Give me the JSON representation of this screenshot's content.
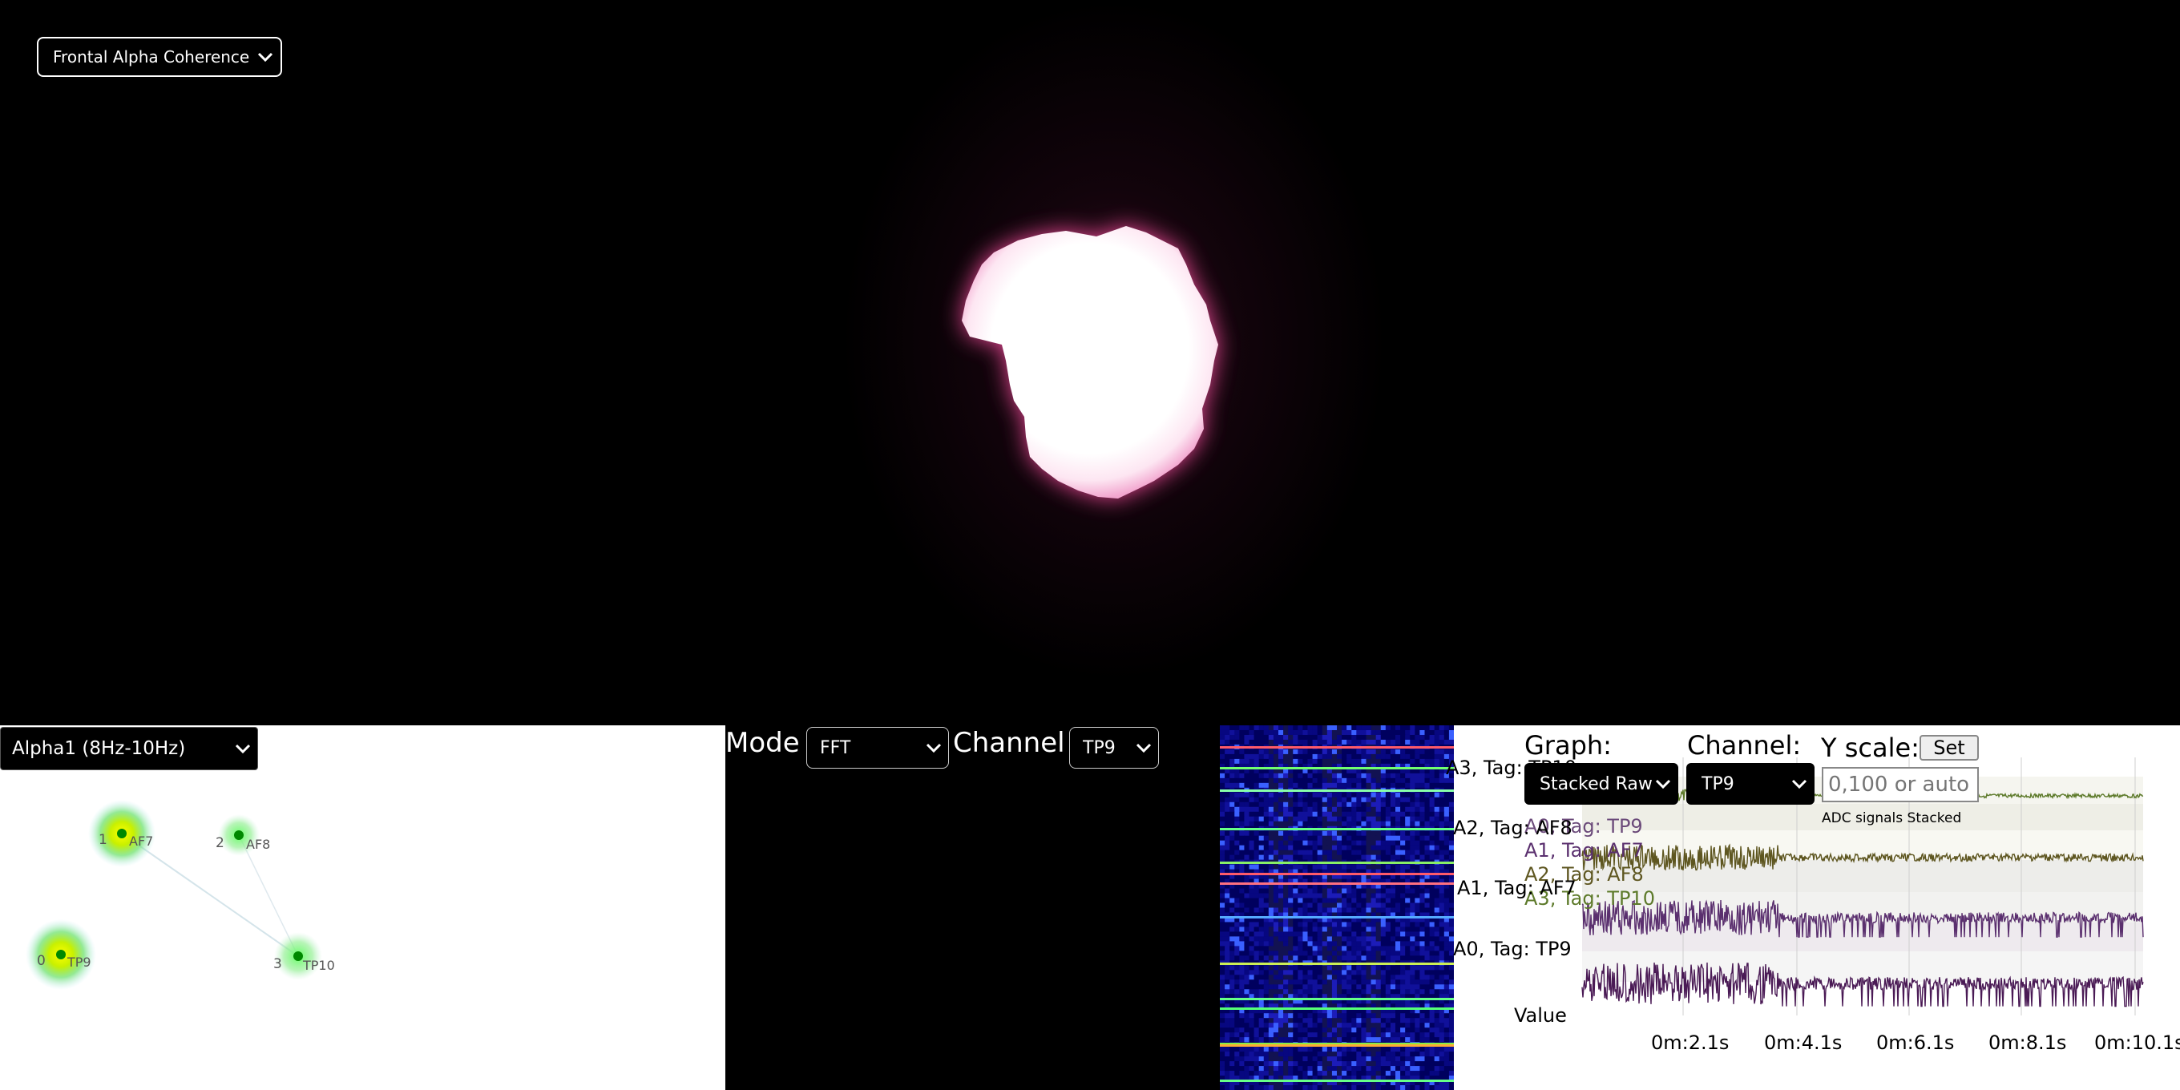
{
  "top": {
    "metric_select": {
      "value": "Frontal Alpha Coherence",
      "options": [
        "Frontal Alpha Coherence"
      ]
    }
  },
  "coherence": {
    "band_select": {
      "value": "Alpha1 (8Hz-10Hz)",
      "options": [
        "Alpha1 (8Hz-10Hz)"
      ]
    },
    "nodes": [
      {
        "index": "1",
        "tag": "AF7"
      },
      {
        "index": "2",
        "tag": "AF8"
      },
      {
        "index": "0",
        "tag": "TP9"
      },
      {
        "index": "3",
        "tag": "TP10"
      }
    ]
  },
  "fft": {
    "mode_label": "Mode",
    "mode_select": {
      "value": "FFT",
      "options": [
        "FFT"
      ]
    },
    "channel_label": "Channel",
    "channel_select": {
      "value": "TP9",
      "options": [
        "TP9"
      ]
    }
  },
  "graph": {
    "graph_label": "Graph:",
    "graph_select": {
      "value": "Stacked Raw",
      "options": [
        "Stacked Raw"
      ]
    },
    "channel_label": "Channel:",
    "channel_select": {
      "value": "TP9",
      "options": [
        "TP9"
      ]
    },
    "yscale_label": "Y scale:",
    "set_button": "Set",
    "yscale_input": {
      "value": "",
      "placeholder": "0,100 or auto"
    },
    "chart_title": "ADC signals Stacked",
    "legend": [
      "A0, Tag: TP9",
      "A1, Tag: AF7",
      "A2, Tag: AF8",
      "A3, Tag: TP10"
    ],
    "row_labels": [
      "A3, Tag: TP10",
      "A2, Tag: AF8",
      "A1, Tag: AF7",
      "A0, Tag: TP9"
    ],
    "y_axis_label": "Value",
    "x_ticks": [
      "0m:2.1s",
      "0m:4.1s",
      "0m:6.1s",
      "0m:8.1s",
      "0m:10.1s"
    ],
    "colors": {
      "A0": "#4a1a55",
      "A1": "#5a2f6e",
      "A2": "#5e5620",
      "A3": "#5d7a2a"
    }
  }
}
